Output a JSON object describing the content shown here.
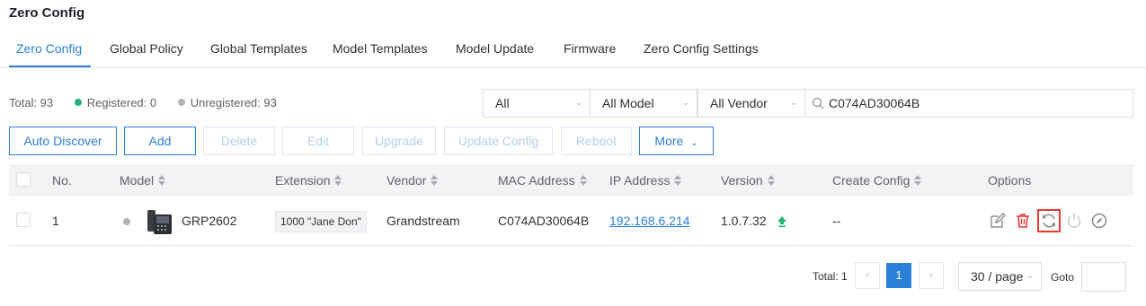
{
  "page": {
    "title": "Zero Config"
  },
  "tabs": [
    {
      "label": "Zero Config",
      "active": true
    },
    {
      "label": "Global Policy"
    },
    {
      "label": "Global Templates"
    },
    {
      "label": "Model Templates"
    },
    {
      "label": "Model Update"
    },
    {
      "label": "Firmware"
    },
    {
      "label": "Zero Config Settings"
    }
  ],
  "stats": {
    "total": "Total: 93",
    "registered": "Registered: 0",
    "unregistered": "Unregistered: 93",
    "colors": {
      "registered": "#21b573",
      "unregistered": "#b0b3b8"
    }
  },
  "filters": {
    "status": "All",
    "model": "All Model",
    "vendor": "All Vendor",
    "search_value": "C074AD30064B"
  },
  "toolbar": {
    "auto_discover": "Auto Discover",
    "add": "Add",
    "delete": "Delete",
    "edit": "Edit",
    "upgrade": "Upgrade",
    "update_config": "Update Config",
    "reboot": "Reboot",
    "more": "More"
  },
  "table": {
    "headers": {
      "no": "No.",
      "model": "Model",
      "extension": "Extension",
      "vendor": "Vendor",
      "mac": "MAC Address",
      "ip": "IP Address",
      "version": "Version",
      "create_config": "Create Config",
      "options": "Options"
    },
    "rows": [
      {
        "no": "1",
        "model": "GRP2602",
        "extension": "1000 \"Jane Don\"",
        "vendor": "Grandstream",
        "mac": "C074AD30064B",
        "ip": "192.168.6.214",
        "version": "1.0.7.32",
        "create_config": "--",
        "options_icons": [
          "edit-icon",
          "delete-icon",
          "sync-icon",
          "power-icon",
          "compass-icon"
        ]
      }
    ]
  },
  "pagination": {
    "total": "Total: 1",
    "current_page": "1",
    "page_size": "30 / page",
    "goto_label": "Goto"
  },
  "colors": {
    "accent": "#2a7fd8",
    "danger": "#e53935",
    "upgrade": "#21b573"
  }
}
